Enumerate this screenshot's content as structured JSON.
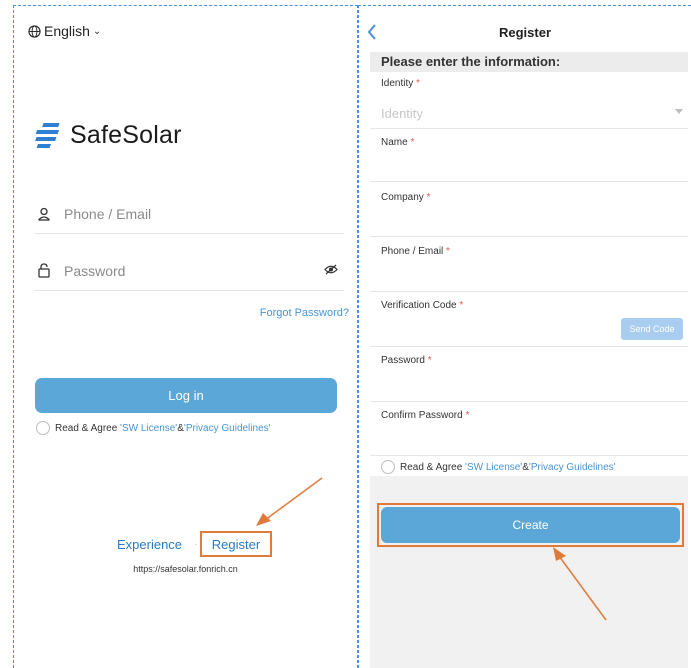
{
  "login": {
    "language": "English",
    "brand": "SafeSolar",
    "phone_placeholder": "Phone / Email",
    "password_placeholder": "Password",
    "forgot": "Forgot Password?",
    "login_button": "Log in",
    "agree_prefix": "Read & Agree ",
    "license": "'SW License'",
    "amp": "&",
    "privacy": "'Privacy Guidelines'",
    "experience": "Experience",
    "register": "Register",
    "site": "https://safesolar.fonrich.cn"
  },
  "register": {
    "title": "Register",
    "banner": "Please enter the information:",
    "fields": {
      "identity": "Identity",
      "identity_placeholder": "Identity",
      "name": "Name",
      "company": "Company",
      "phone": "Phone / Email",
      "verification": "Verification Code",
      "password": "Password",
      "confirm": "Confirm Password"
    },
    "required_mark": "*",
    "send_code": "Send Code",
    "agree_prefix": "Read & Agree ",
    "license": "'SW License'",
    "amp": "&",
    "privacy": "'Privacy Guidelines'",
    "create_button": "Create"
  },
  "colors": {
    "primary": "#5aa7d8",
    "link": "#4a94d6",
    "highlight": "#e07a3b",
    "required": "#e05a5a"
  }
}
